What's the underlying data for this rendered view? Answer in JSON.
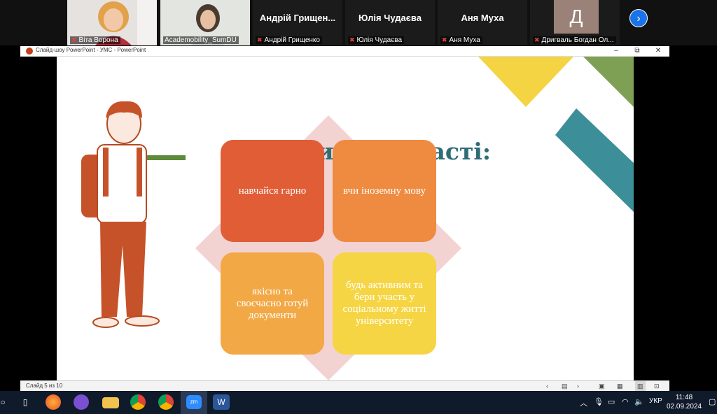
{
  "participants": [
    {
      "name": "Віта Ворона",
      "display": ""
    },
    {
      "name": "Academobility_SumDU",
      "display": ""
    },
    {
      "name": "Андрій Грищенко",
      "display": "Андрій Грищен..."
    },
    {
      "name": "Юлія Чудаєва",
      "display": "Юлія Чудаєва"
    },
    {
      "name": "Аня Муха",
      "display": "Аня Муха"
    },
    {
      "name": "Дригваль Богдан Ол...",
      "display": "Д"
    }
  ],
  "window": {
    "title": "Слайд-шоу PowerPoint  -  УМС - PowerPoint",
    "min": "–",
    "restore": "⧉",
    "close": "✕"
  },
  "slide": {
    "title": "4 кроки для участі:",
    "steps": [
      {
        "text": "навчайся гарно"
      },
      {
        "text": "вчи іноземну мову"
      },
      {
        "text": "якісно та своєчасно готуй документи"
      },
      {
        "text": "будь активним та бери участь у соціальному житті університету"
      }
    ]
  },
  "status": {
    "slide_counter": "Слайд 5 из 10"
  },
  "taskbar": {
    "language": "УКР",
    "time": "11:48",
    "date": "02.09.2024"
  }
}
